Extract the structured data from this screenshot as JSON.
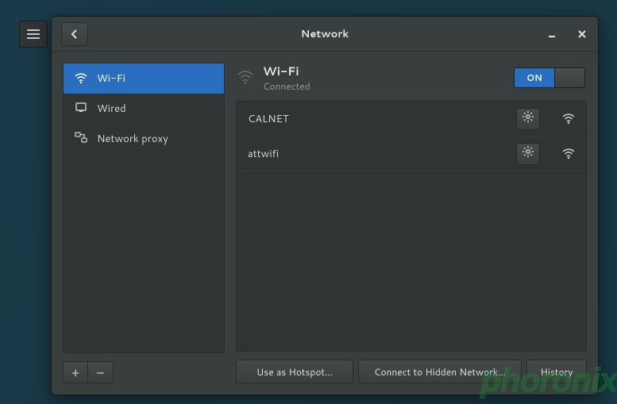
{
  "window": {
    "title": "Network",
    "minimize_tooltip": "Minimize",
    "close_tooltip": "Close",
    "back_tooltip": "Back"
  },
  "sidebar": {
    "items": [
      {
        "label": "Wi-Fi"
      },
      {
        "label": "Wired"
      },
      {
        "label": "Network proxy"
      }
    ],
    "add_label": "+",
    "remove_label": "–"
  },
  "main": {
    "heading": "Wi-Fi",
    "status": "Connected",
    "toggle_on_label": "ON",
    "networks": [
      {
        "ssid": "CALNET"
      },
      {
        "ssid": "attwifi"
      }
    ],
    "hotspot_btn": "Use as Hotspot...",
    "hidden_btn": "Connect to Hidden Network...",
    "history_btn": "History"
  },
  "watermark": "phoronix"
}
